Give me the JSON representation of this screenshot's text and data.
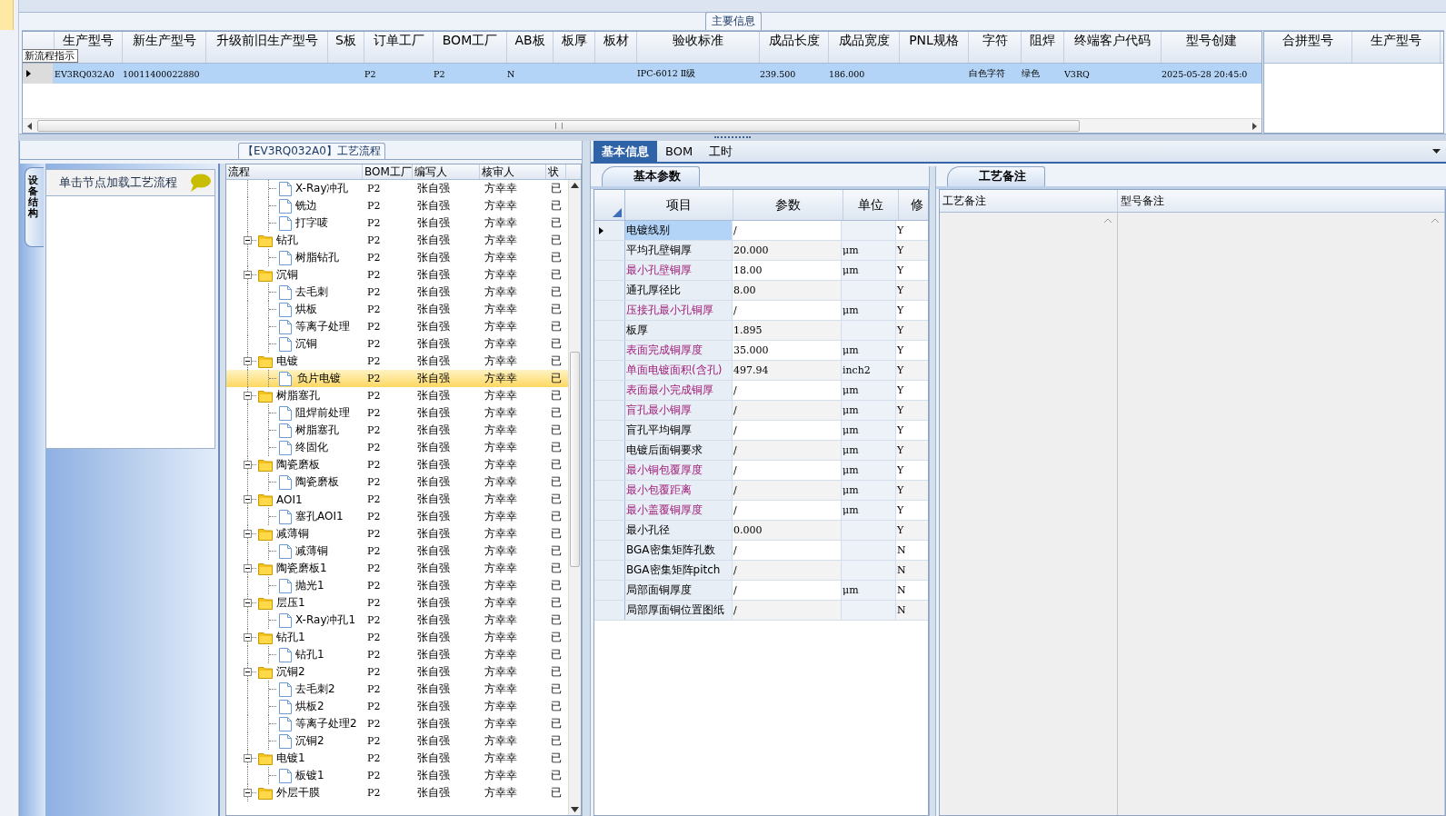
{
  "main_info": {
    "group_title": "主要信息",
    "tooltip": "新流程指示",
    "columns": [
      "生产型号",
      "新生产型号",
      "升级前旧生产型号",
      "S板",
      "订单工厂",
      "BOM工厂",
      "AB板",
      "板厚",
      "板材",
      "验收标准",
      "成品长度",
      "成品宽度",
      "PNL规格",
      "字符",
      "阻焊",
      "终端客户代码",
      "型号创建"
    ],
    "rows": [
      {
        "selected": true,
        "cells": [
          "EV3RQ032A0",
          "10011400022880",
          null,
          null,
          "P2",
          "P2",
          "N",
          null,
          null,
          "IPC-6012 Ⅱ级",
          "239.500",
          "186.000",
          null,
          "白色字符",
          "绿色",
          "V3RQ",
          "2025-05-28 20:45:0"
        ]
      }
    ],
    "merge_columns": [
      "合拼型号",
      "生产型号"
    ]
  },
  "process_panel": {
    "title": "【EV3RQ032A0】工艺流程",
    "side_tab": "设备结构",
    "hint": "单击节点加载工艺流程"
  },
  "process_tree": {
    "columns": [
      "流程",
      "BOM工厂",
      "编写人",
      "核审人",
      "状"
    ],
    "continued_children": [
      {
        "label": "X-Ray冲孔",
        "bom_factory": "P2",
        "writer": "张自强",
        "reviewer": "方幸幸",
        "status": "已",
        "selected": false
      },
      {
        "label": "铣边",
        "bom_factory": "P2",
        "writer": "张自强",
        "reviewer": "方幸幸",
        "status": "已",
        "selected": false
      },
      {
        "label": "打字唛",
        "bom_factory": "P2",
        "writer": "张自强",
        "reviewer": "方幸幸",
        "status": "已",
        "selected": false
      }
    ],
    "nodes": [
      {
        "label": "钻孔",
        "bom_factory": "P2",
        "writer": "张自强",
        "reviewer": "方幸幸",
        "status": "已",
        "selected": false,
        "expanded": true,
        "children": [
          {
            "label": "树脂钻孔",
            "bom_factory": "P2",
            "writer": "张自强",
            "reviewer": "方幸幸",
            "status": "已",
            "selected": false
          }
        ]
      },
      {
        "label": "沉铜",
        "bom_factory": "P2",
        "writer": "张自强",
        "reviewer": "方幸幸",
        "status": "已",
        "selected": false,
        "expanded": true,
        "children": [
          {
            "label": "去毛刺",
            "bom_factory": "P2",
            "writer": "张自强",
            "reviewer": "方幸幸",
            "status": "已",
            "selected": false
          },
          {
            "label": "烘板",
            "bom_factory": "P2",
            "writer": "张自强",
            "reviewer": "方幸幸",
            "status": "已",
            "selected": false
          },
          {
            "label": "等离子处理",
            "bom_factory": "P2",
            "writer": "张自强",
            "reviewer": "方幸幸",
            "status": "已",
            "selected": false
          },
          {
            "label": "沉铜",
            "bom_factory": "P2",
            "writer": "张自强",
            "reviewer": "方幸幸",
            "status": "已",
            "selected": false
          }
        ]
      },
      {
        "label": "电镀",
        "bom_factory": "P2",
        "writer": "张自强",
        "reviewer": "方幸幸",
        "status": "已",
        "selected": false,
        "expanded": true,
        "children": [
          {
            "label": "负片电镀",
            "bom_factory": "P2",
            "writer": "张自强",
            "reviewer": "方幸幸",
            "status": "已",
            "selected": true
          }
        ]
      },
      {
        "label": "树脂塞孔",
        "bom_factory": "P2",
        "writer": "张自强",
        "reviewer": "方幸幸",
        "status": "已",
        "selected": false,
        "expanded": true,
        "children": [
          {
            "label": "阻焊前处理",
            "bom_factory": "P2",
            "writer": "张自强",
            "reviewer": "方幸幸",
            "status": "已",
            "selected": false
          },
          {
            "label": "树脂塞孔",
            "bom_factory": "P2",
            "writer": "张自强",
            "reviewer": "方幸幸",
            "status": "已",
            "selected": false
          },
          {
            "label": "终固化",
            "bom_factory": "P2",
            "writer": "张自强",
            "reviewer": "方幸幸",
            "status": "已",
            "selected": false
          }
        ]
      },
      {
        "label": "陶瓷磨板",
        "bom_factory": "P2",
        "writer": "张自强",
        "reviewer": "方幸幸",
        "status": "已",
        "selected": false,
        "expanded": true,
        "children": [
          {
            "label": "陶瓷磨板",
            "bom_factory": "P2",
            "writer": "张自强",
            "reviewer": "方幸幸",
            "status": "已",
            "selected": false
          }
        ]
      },
      {
        "label": "AOI1",
        "bom_factory": "P2",
        "writer": "张自强",
        "reviewer": "方幸幸",
        "status": "已",
        "selected": false,
        "expanded": true,
        "children": [
          {
            "label": "塞孔AOI1",
            "bom_factory": "P2",
            "writer": "张自强",
            "reviewer": "方幸幸",
            "status": "已",
            "selected": false
          }
        ]
      },
      {
        "label": "减薄铜",
        "bom_factory": "P2",
        "writer": "张自强",
        "reviewer": "方幸幸",
        "status": "已",
        "selected": false,
        "expanded": true,
        "children": [
          {
            "label": "减薄铜",
            "bom_factory": "P2",
            "writer": "张自强",
            "reviewer": "方幸幸",
            "status": "已",
            "selected": false
          }
        ]
      },
      {
        "label": "陶瓷磨板1",
        "bom_factory": "P2",
        "writer": "张自强",
        "reviewer": "方幸幸",
        "status": "已",
        "selected": false,
        "expanded": true,
        "children": [
          {
            "label": "抛光1",
            "bom_factory": "P2",
            "writer": "张自强",
            "reviewer": "方幸幸",
            "status": "已",
            "selected": false
          }
        ]
      },
      {
        "label": "层压1",
        "bom_factory": "P2",
        "writer": "张自强",
        "reviewer": "方幸幸",
        "status": "已",
        "selected": false,
        "expanded": true,
        "children": [
          {
            "label": "X-Ray冲孔1",
            "bom_factory": "P2",
            "writer": "张自强",
            "reviewer": "方幸幸",
            "status": "已",
            "selected": false
          }
        ]
      },
      {
        "label": "钻孔1",
        "bom_factory": "P2",
        "writer": "张自强",
        "reviewer": "方幸幸",
        "status": "已",
        "selected": false,
        "expanded": true,
        "children": [
          {
            "label": "钻孔1",
            "bom_factory": "P2",
            "writer": "张自强",
            "reviewer": "方幸幸",
            "status": "已",
            "selected": false
          }
        ]
      },
      {
        "label": "沉铜2",
        "bom_factory": "P2",
        "writer": "张自强",
        "reviewer": "方幸幸",
        "status": "已",
        "selected": false,
        "expanded": true,
        "children": [
          {
            "label": "去毛刺2",
            "bom_factory": "P2",
            "writer": "张自强",
            "reviewer": "方幸幸",
            "status": "已",
            "selected": false
          },
          {
            "label": "烘板2",
            "bom_factory": "P2",
            "writer": "张自强",
            "reviewer": "方幸幸",
            "status": "已",
            "selected": false
          },
          {
            "label": "等离子处理2",
            "bom_factory": "P2",
            "writer": "张自强",
            "reviewer": "方幸幸",
            "status": "已",
            "selected": false
          },
          {
            "label": "沉铜2",
            "bom_factory": "P2",
            "writer": "张自强",
            "reviewer": "方幸幸",
            "status": "已",
            "selected": false
          }
        ]
      },
      {
        "label": "电镀1",
        "bom_factory": "P2",
        "writer": "张自强",
        "reviewer": "方幸幸",
        "status": "已",
        "selected": false,
        "expanded": true,
        "children": [
          {
            "label": "板镀1",
            "bom_factory": "P2",
            "writer": "张自强",
            "reviewer": "方幸幸",
            "status": "已",
            "selected": false
          }
        ]
      },
      {
        "label": "外层干膜",
        "bom_factory": "P2",
        "writer": "张自强",
        "reviewer": "方幸幸",
        "status": "已",
        "selected": false,
        "expanded": true
      }
    ]
  },
  "detail_tabs": [
    {
      "label": "基本信息",
      "selected": true
    },
    {
      "label": "BOM",
      "selected": false
    },
    {
      "label": "工时",
      "selected": false
    }
  ],
  "basic_params": {
    "tab": "基本参数",
    "columns": [
      "项目",
      "参数",
      "单位",
      "修"
    ],
    "rows": [
      {
        "name": "电镀线别",
        "value": "/",
        "unit": null,
        "modify": "Y",
        "flagged": false,
        "selected": true
      },
      {
        "name": "平均孔壁铜厚",
        "value": "20.000",
        "unit": "μm",
        "modify": "Y",
        "flagged": false,
        "selected": false
      },
      {
        "name": "最小孔壁铜厚",
        "value": "18.00",
        "unit": "μm",
        "modify": "Y",
        "flagged": true,
        "selected": false
      },
      {
        "name": "通孔厚径比",
        "value": "8.00",
        "unit": null,
        "modify": "Y",
        "flagged": false,
        "selected": false
      },
      {
        "name": "压接孔最小孔铜厚",
        "value": "/",
        "unit": "μm",
        "modify": "Y",
        "flagged": true,
        "selected": false
      },
      {
        "name": "板厚",
        "value": "1.895",
        "unit": null,
        "modify": "Y",
        "flagged": false,
        "selected": false
      },
      {
        "name": "表面完成铜厚度",
        "value": "35.000",
        "unit": "μm",
        "modify": "Y",
        "flagged": true,
        "selected": false
      },
      {
        "name": "单面电镀面积(含孔)",
        "value": "497.94",
        "unit": "inch2",
        "modify": "Y",
        "flagged": true,
        "selected": false
      },
      {
        "name": "表面最小完成铜厚",
        "value": "/",
        "unit": "μm",
        "modify": "Y",
        "flagged": true,
        "selected": false
      },
      {
        "name": "盲孔最小铜厚",
        "value": "/",
        "unit": "μm",
        "modify": "Y",
        "flagged": true,
        "selected": false
      },
      {
        "name": "盲孔平均铜厚",
        "value": "/",
        "unit": "μm",
        "modify": "Y",
        "flagged": false,
        "selected": false
      },
      {
        "name": "电镀后面铜要求",
        "value": "/",
        "unit": "μm",
        "modify": "Y",
        "flagged": false,
        "selected": false
      },
      {
        "name": "最小铜包覆厚度",
        "value": "/",
        "unit": "μm",
        "modify": "Y",
        "flagged": true,
        "selected": false
      },
      {
        "name": "最小包覆距离",
        "value": "/",
        "unit": "μm",
        "modify": "Y",
        "flagged": true,
        "selected": false
      },
      {
        "name": "最小盖覆铜厚度",
        "value": "/",
        "unit": "μm",
        "modify": "Y",
        "flagged": true,
        "selected": false
      },
      {
        "name": "最小孔径",
        "value": "0.000",
        "unit": null,
        "modify": "Y",
        "flagged": false,
        "selected": false
      },
      {
        "name": "BGA密集矩阵孔数",
        "value": "/",
        "unit": null,
        "modify": "N",
        "flagged": false,
        "selected": false
      },
      {
        "name": "BGA密集矩阵pitch",
        "value": "/",
        "unit": null,
        "modify": "N",
        "flagged": false,
        "selected": false
      },
      {
        "name": "局部面铜厚度",
        "value": "/",
        "unit": "μm",
        "modify": "N",
        "flagged": false,
        "selected": false
      },
      {
        "name": "局部厚面铜位置图纸",
        "value": "/",
        "unit": null,
        "modify": "N",
        "flagged": false,
        "selected": false
      }
    ]
  },
  "process_notes": {
    "tab": "工艺备注",
    "columns": [
      "工艺备注",
      "型号备注"
    ]
  }
}
